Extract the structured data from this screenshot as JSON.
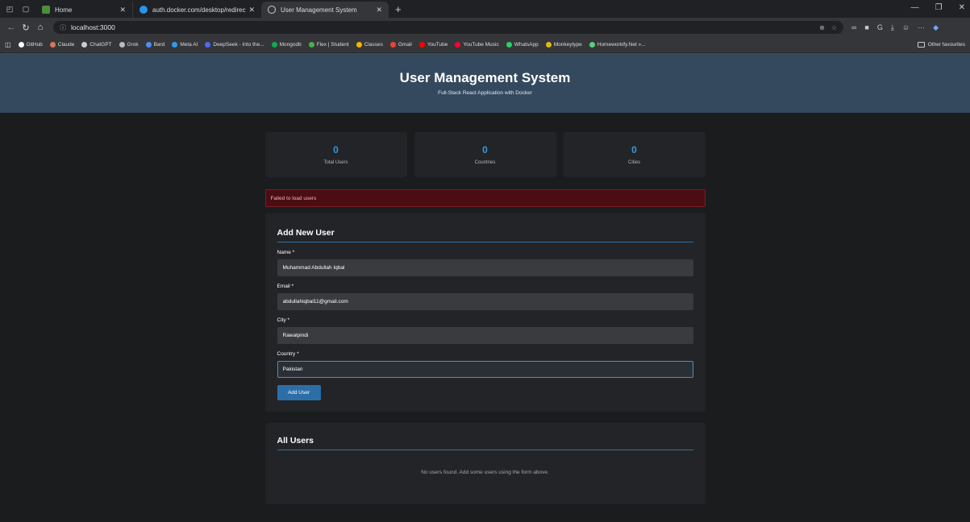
{
  "browser": {
    "tabs": [
      {
        "label": "Home",
        "active": false
      },
      {
        "label": "auth.docker.com/desktop/redirec",
        "active": false
      },
      {
        "label": "User Management System",
        "active": true
      }
    ],
    "url": "localhost:3000",
    "bookmarks": [
      {
        "label": "GitHub",
        "color": "#ffffff"
      },
      {
        "label": "Claude",
        "color": "#d97757"
      },
      {
        "label": "ChatGPT",
        "color": "#cccccc"
      },
      {
        "label": "Grok",
        "color": "#bbbbbb"
      },
      {
        "label": "Bard",
        "color": "#4b8df8"
      },
      {
        "label": "Meta AI",
        "color": "#2d9cf0"
      },
      {
        "label": "DeepSeek - Into the...",
        "color": "#4d6bfe"
      },
      {
        "label": "Mongodb",
        "color": "#10aa50"
      },
      {
        "label": "Flex | Student",
        "color": "#4caf50"
      },
      {
        "label": "Classes",
        "color": "#f4b400"
      },
      {
        "label": "Gmail",
        "color": "#ea4335"
      },
      {
        "label": "YouTube",
        "color": "#ff0000"
      },
      {
        "label": "YouTube Music",
        "color": "#ff0033"
      },
      {
        "label": "WhatsApp",
        "color": "#25d366"
      },
      {
        "label": "Monkeytype",
        "color": "#e2b714"
      },
      {
        "label": "Homeworkify.Net »...",
        "color": "#5ccf7a"
      }
    ],
    "other_favourites": "Other favourites"
  },
  "app": {
    "title": "User Management System",
    "subtitle": "Full-Stack React Application with Docker"
  },
  "stats": [
    {
      "value": "0",
      "label": "Total Users"
    },
    {
      "value": "0",
      "label": "Countries"
    },
    {
      "value": "0",
      "label": "Cities"
    }
  ],
  "error": "Failed to load users",
  "form": {
    "title": "Add New User",
    "name_label": "Name *",
    "name_value": "Muhammad Abdullah Iqbal",
    "email_label": "Email *",
    "email_value": "abdullahiqbal11@gmail.com",
    "city_label": "City *",
    "city_value": "Rawalpindi",
    "country_label": "Country *",
    "country_value": "Pakistan",
    "submit_label": "Add User"
  },
  "users": {
    "title": "All Users",
    "empty_message": "No users found. Add some users using the form above."
  },
  "colors": {
    "header_bg": "#34495e",
    "accent": "#3498db",
    "error_bg": "#4a0d12",
    "button": "#2c6fa8"
  }
}
